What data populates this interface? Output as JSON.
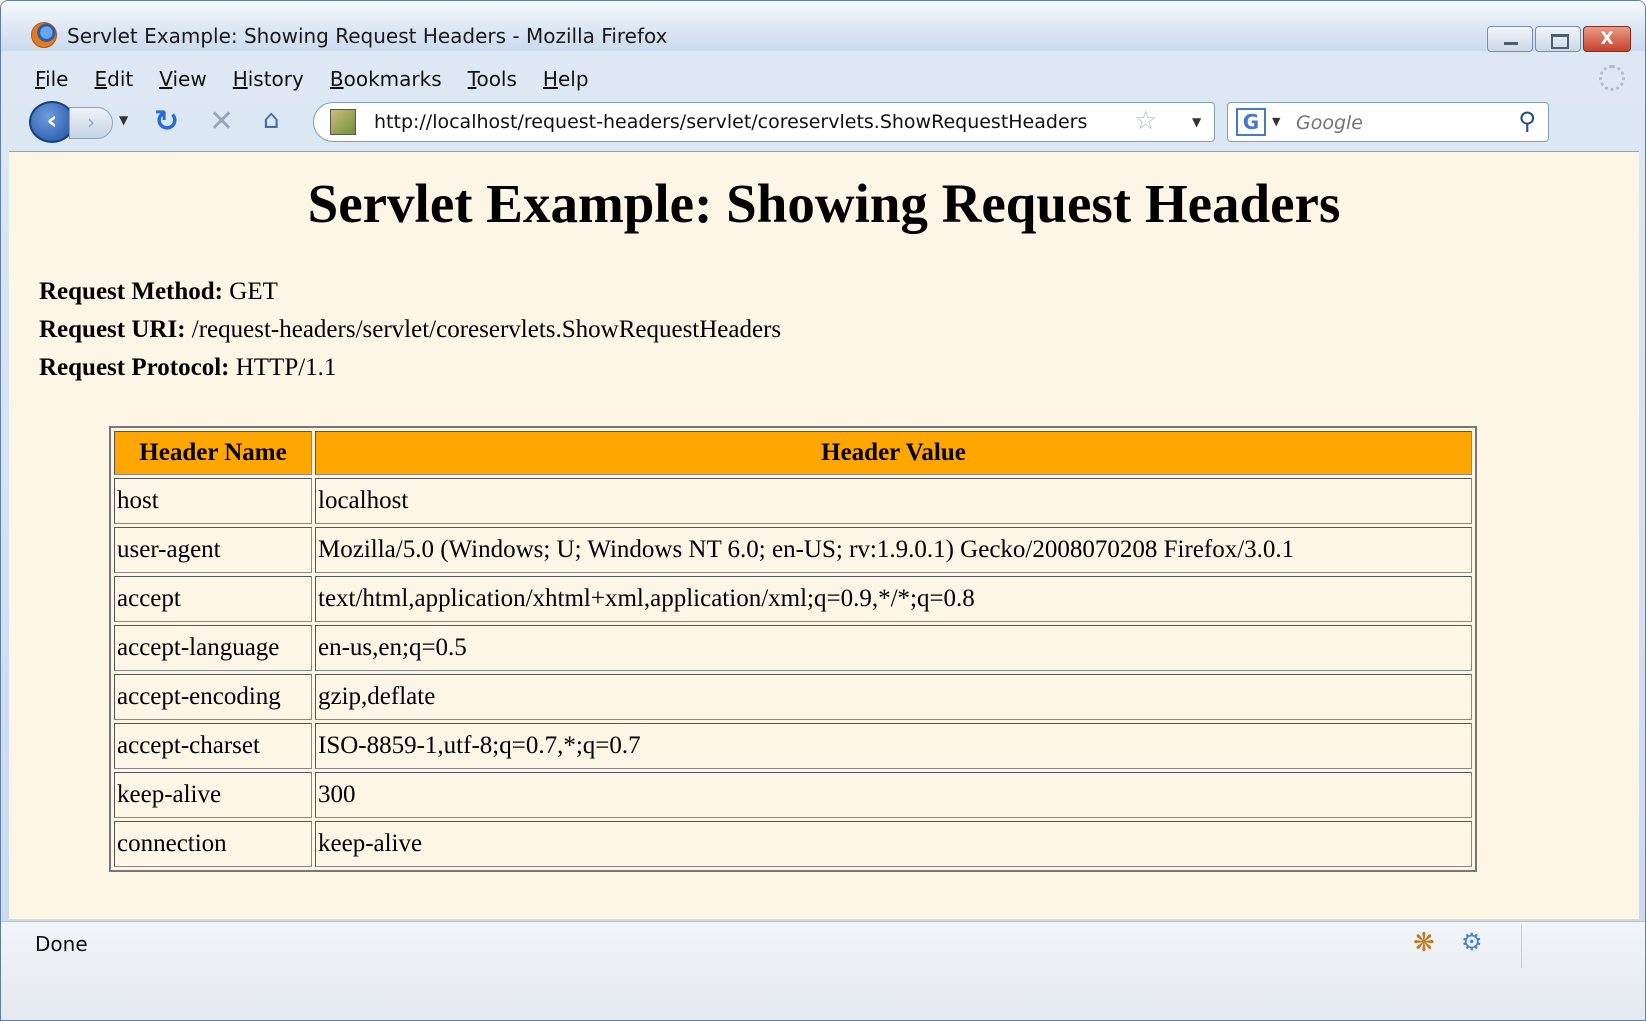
{
  "window": {
    "title": "Servlet Example: Showing Request Headers - Mozilla Firefox",
    "close_label": "X"
  },
  "menu": [
    "File",
    "Edit",
    "View",
    "History",
    "Bookmarks",
    "Tools",
    "Help"
  ],
  "nav": {
    "url": "http://localhost/request-headers/servlet/coreservlets.ShowRequestHeaders",
    "search_placeholder": "Google",
    "search_engine": "G"
  },
  "page": {
    "heading": "Servlet Example: Showing Request Headers",
    "request_method_label": "Request Method:",
    "request_method_value": "GET",
    "request_uri_label": "Request URI:",
    "request_uri_value": "/request-headers/servlet/coreservlets.ShowRequestHeaders",
    "request_protocol_label": "Request Protocol:",
    "request_protocol_value": "HTTP/1.1",
    "table": {
      "columns": [
        "Header Name",
        "Header Value"
      ],
      "rows": [
        {
          "name": "host",
          "value": "localhost"
        },
        {
          "name": "user-agent",
          "value": "Mozilla/5.0 (Windows; U; Windows NT 6.0; en-US; rv:1.9.0.1) Gecko/2008070208 Firefox/3.0.1"
        },
        {
          "name": "accept",
          "value": "text/html,application/xhtml+xml,application/xml;q=0.9,*/*;q=0.8"
        },
        {
          "name": "accept-language",
          "value": "en-us,en;q=0.5"
        },
        {
          "name": "accept-encoding",
          "value": "gzip,deflate"
        },
        {
          "name": "accept-charset",
          "value": "ISO-8859-1,utf-8;q=0.7,*;q=0.7"
        },
        {
          "name": "keep-alive",
          "value": "300"
        },
        {
          "name": "connection",
          "value": "keep-alive"
        }
      ],
      "header_color": "#ffa600"
    },
    "background": "#fdf5e6"
  },
  "status": {
    "text": "Done"
  }
}
